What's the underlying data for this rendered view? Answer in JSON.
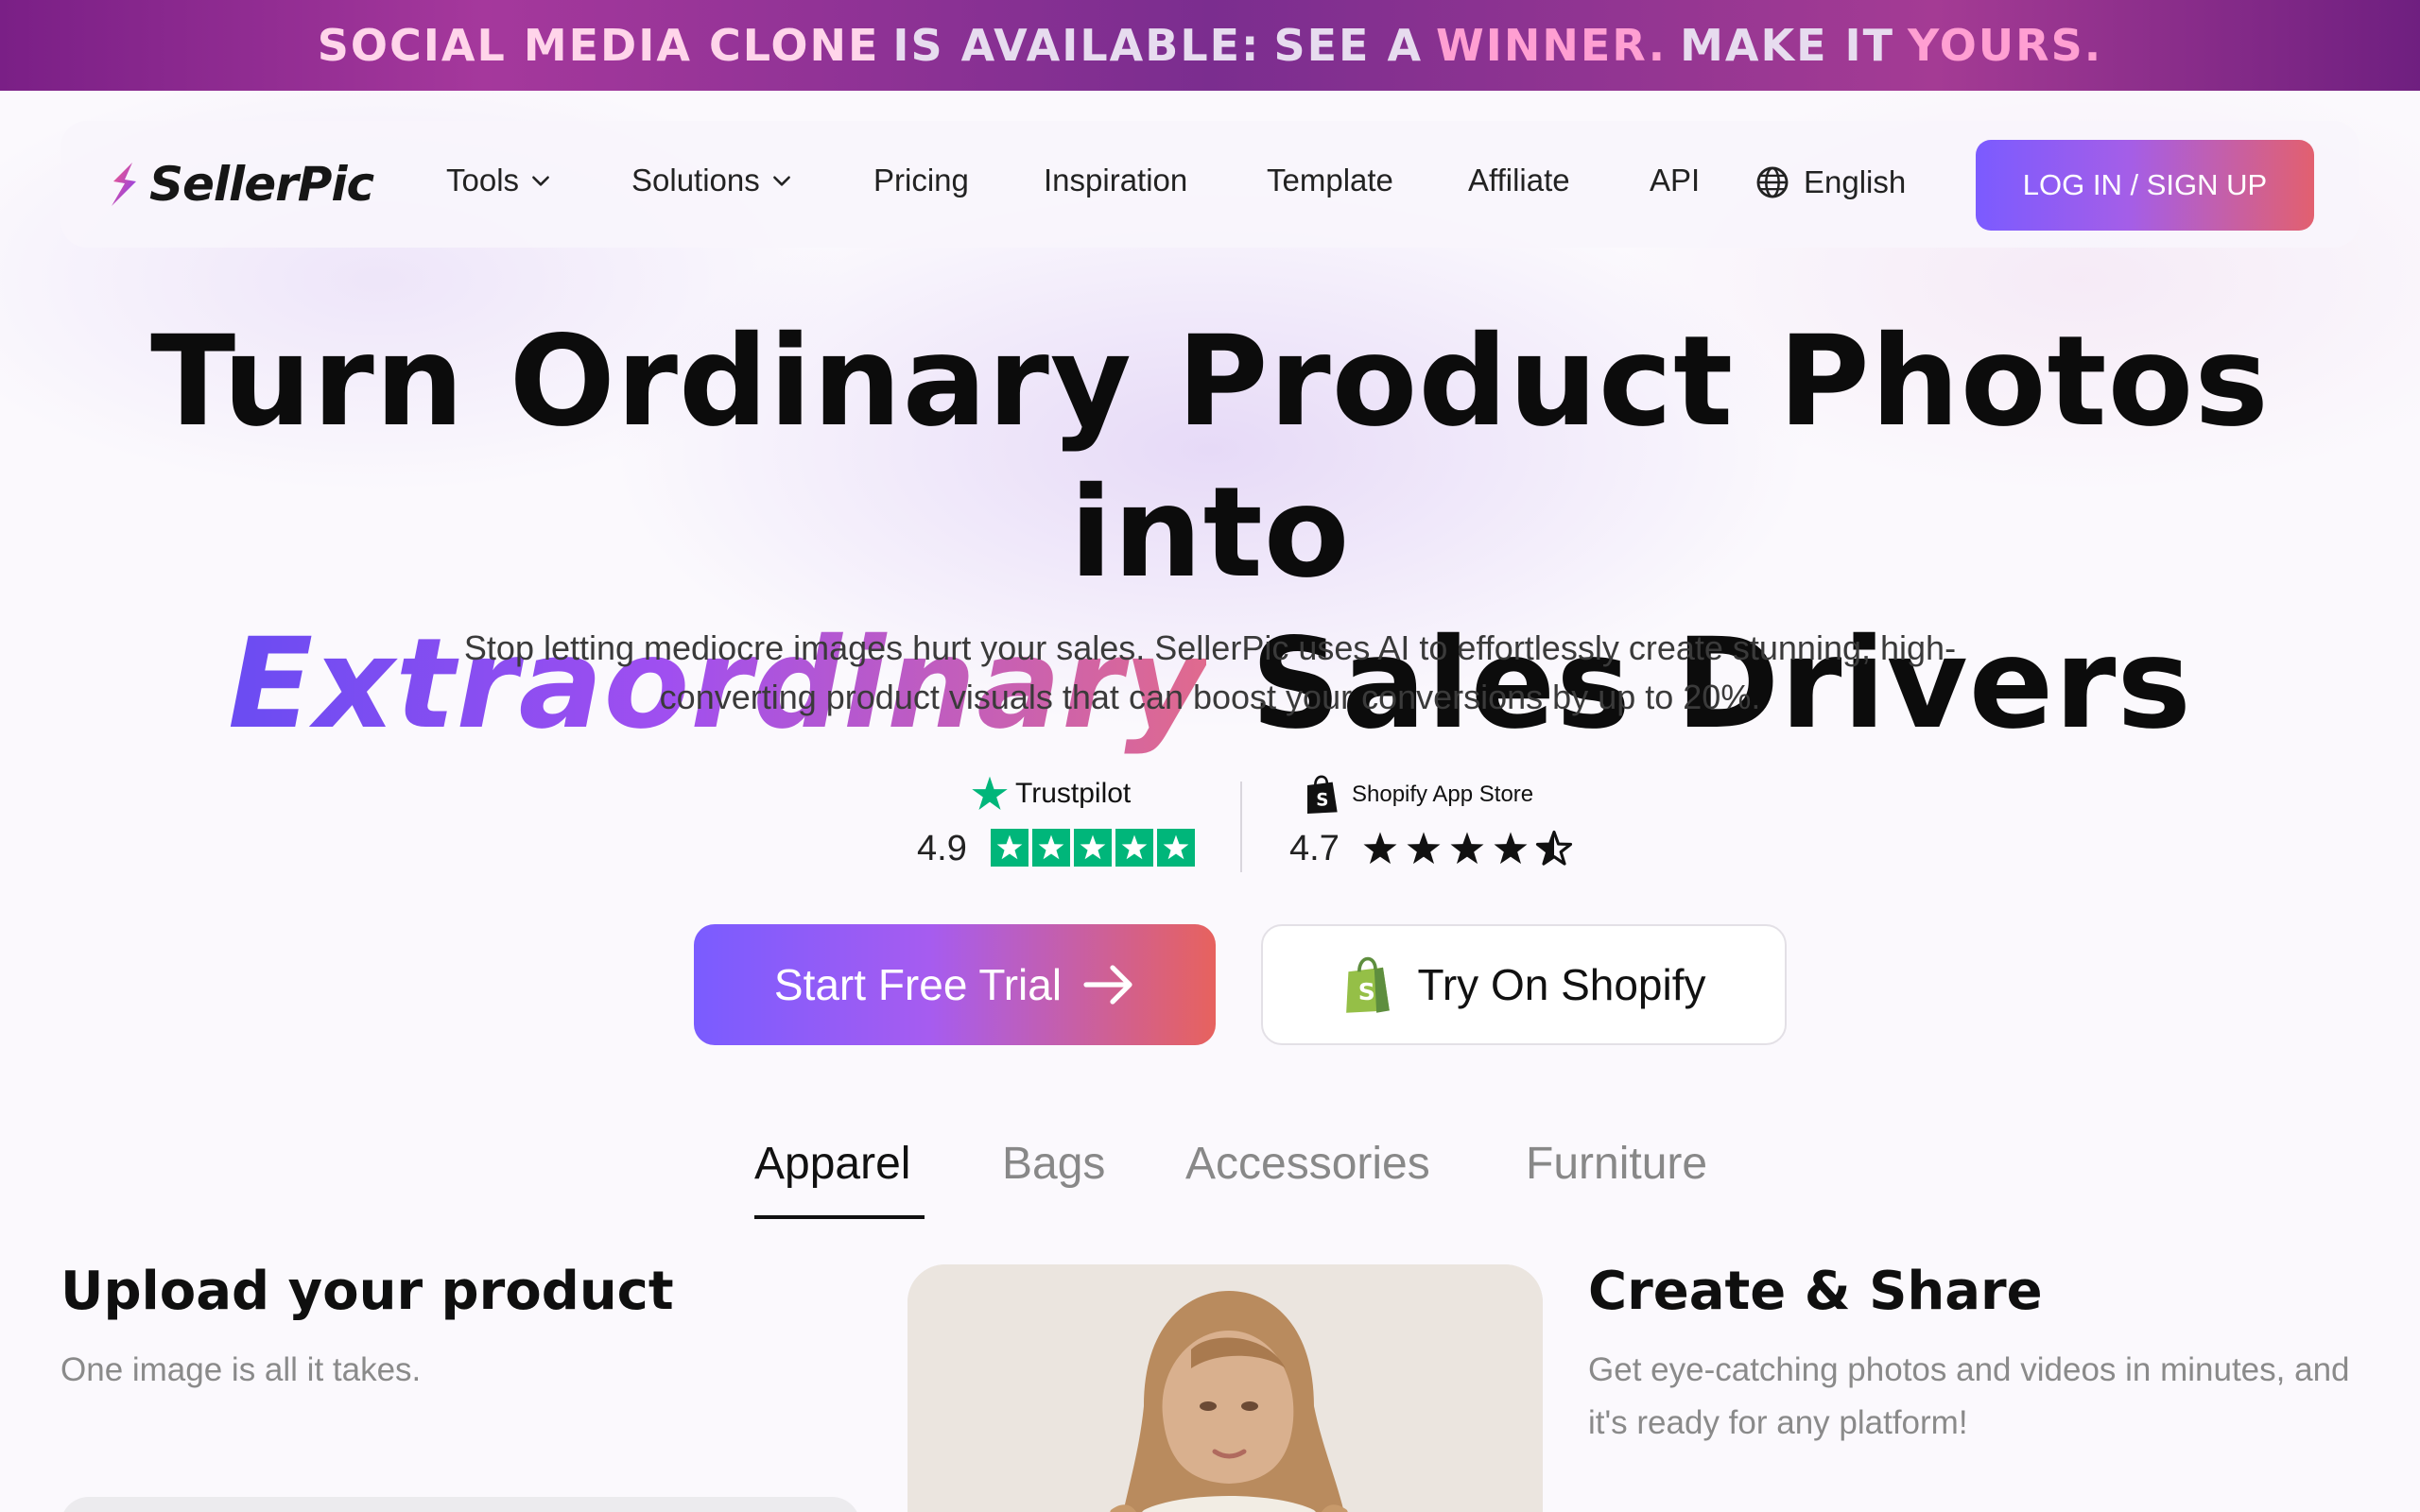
{
  "banner": {
    "parts": [
      {
        "text": "SOCIAL MEDIA CLONE",
        "style": "hl"
      },
      {
        "text": "IS AVAILABLE:",
        "style": "normal"
      },
      {
        "text": "SEE A",
        "style": "normal"
      },
      {
        "text": "WINNER.",
        "style": "pink"
      },
      {
        "text": "MAKE IT",
        "style": "normal"
      },
      {
        "text": "YOURS.",
        "style": "pink"
      }
    ]
  },
  "nav": {
    "logo_text": "SellerPic",
    "items": {
      "tools": "Tools",
      "solutions": "Solutions",
      "pricing": "Pricing",
      "inspiration": "Inspiration",
      "template": "Template",
      "affiliate": "Affiliate",
      "api": "API"
    },
    "language": "English",
    "login_label": "LOG IN / SIGN UP"
  },
  "hero": {
    "headline_line1": "Turn Ordinary Product Photos into",
    "headline_highlight": "Extraordinary",
    "headline_line2_rest": "Sales Drivers",
    "subtitle": "Stop letting mediocre images hurt your sales. SellerPic uses AI to effortlessly create stunning, high-converting product visuals that can boost your conversions by up to 20%."
  },
  "ratings": {
    "trustpilot": {
      "name": "Trustpilot",
      "score": "4.9",
      "stars": 5,
      "color": "#00b67a"
    },
    "shopify": {
      "name": "Shopify App Store",
      "score": "4.7",
      "stars": 4.5
    }
  },
  "cta": {
    "primary_label": "Start Free Trial",
    "secondary_label": "Try On Shopify"
  },
  "tabs": {
    "items": [
      "Apparel",
      "Bags",
      "Accessories",
      "Furniture"
    ],
    "active": "Apparel"
  },
  "steps": {
    "upload_title": "Upload your product",
    "upload_text": "One image is all it takes.",
    "create_title": "Create & Share",
    "create_text": "Get eye-catching photos and videos in minutes, and it's ready for any platform!"
  },
  "colors": {
    "accent_start": "#7a5cff",
    "accent_end": "#e7625e",
    "banner_bg": "#7b2d8f"
  }
}
